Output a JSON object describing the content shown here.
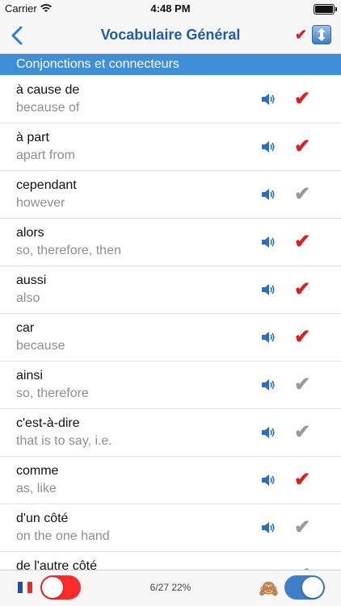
{
  "status": {
    "carrier": "Carrier",
    "time": "4:48 PM",
    "battery_level": 1.0
  },
  "nav": {
    "title": "Vocabulaire Général",
    "check": "✔"
  },
  "section": {
    "title": "Conjonctions et connecteurs"
  },
  "colors": {
    "checked": "#e02020",
    "unchecked": "#9a9a9a",
    "accent": "#3f8ed8"
  },
  "rows": [
    {
      "fr": "à cause de",
      "en": "because of",
      "checked": true
    },
    {
      "fr": "à part",
      "en": "apart from",
      "checked": true
    },
    {
      "fr": "cependant",
      "en": "however",
      "checked": false
    },
    {
      "fr": "alors",
      "en": "so, therefore, then",
      "checked": true
    },
    {
      "fr": "aussi",
      "en": "also",
      "checked": true
    },
    {
      "fr": "car",
      "en": "because",
      "checked": true
    },
    {
      "fr": "ainsi",
      "en": "so, therefore",
      "checked": false
    },
    {
      "fr": "c'est-à-dire",
      "en": "that is to say, i.e.",
      "checked": false
    },
    {
      "fr": "comme",
      "en": "as, like",
      "checked": true
    },
    {
      "fr": "d'un côté",
      "en": "on the one hand",
      "checked": false
    },
    {
      "fr": "de l'autre côté",
      "en": "",
      "checked": false
    }
  ],
  "toolbar": {
    "progress": "6/27 22%",
    "monkey": "🙈",
    "left_toggle_on": true,
    "right_toggle_on": true
  }
}
